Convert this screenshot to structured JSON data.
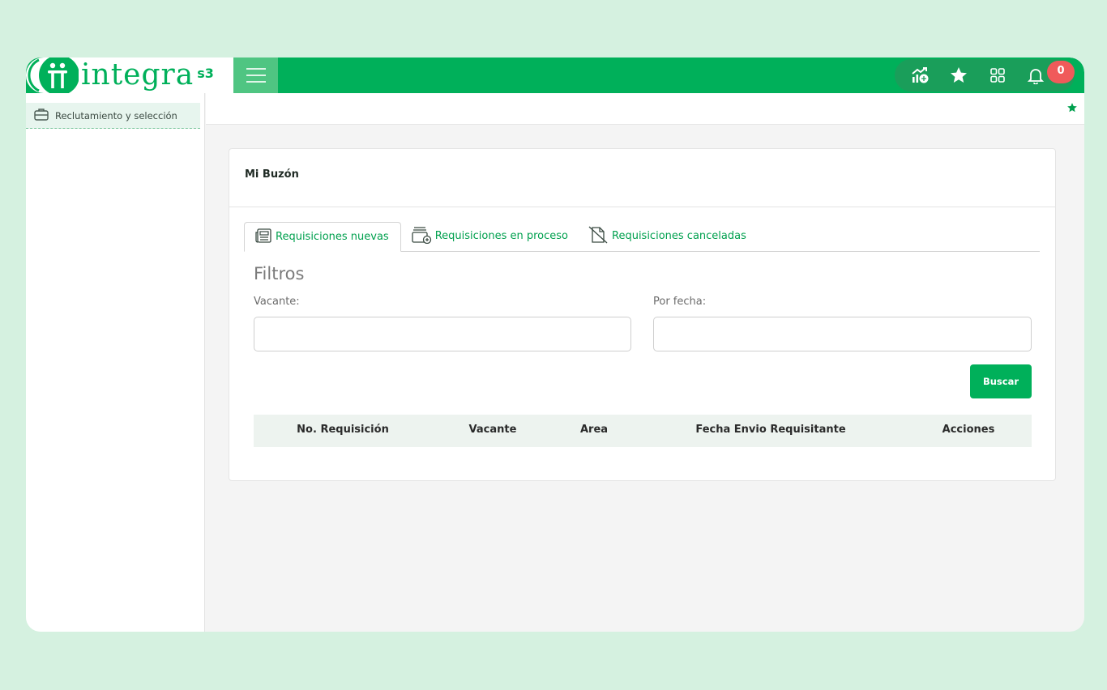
{
  "brand": {
    "logo_text": "integra",
    "logo_suffix": "s3"
  },
  "topbar": {
    "icons": [
      "stats-icon",
      "star-icon",
      "apps-grid-icon",
      "bell-icon"
    ],
    "notification_count": "0",
    "accent": "#00b05a"
  },
  "sidebar": {
    "items": [
      {
        "label": "Reclutamiento y selección",
        "icon": "briefcase-icon"
      }
    ]
  },
  "card": {
    "title": "Mi Buzón",
    "tabs": [
      {
        "label": "Requisiciones nuevas",
        "icon": "newspaper-icon",
        "active": true
      },
      {
        "label": "Requisiciones en proceso",
        "icon": "folder-plus-icon",
        "active": false
      },
      {
        "label": "Requisiciones canceladas",
        "icon": "document-cancel-icon",
        "active": false
      }
    ],
    "filters": {
      "title": "Filtros",
      "vacante_label": "Vacante:",
      "vacante_value": "",
      "fecha_label": "Por fecha:",
      "fecha_value": ""
    },
    "search_button": "Buscar",
    "table": {
      "columns": [
        "No. Requisición",
        "Vacante",
        "Area",
        "Fecha Envio Requisitante",
        "Acciones"
      ],
      "rows": []
    }
  }
}
